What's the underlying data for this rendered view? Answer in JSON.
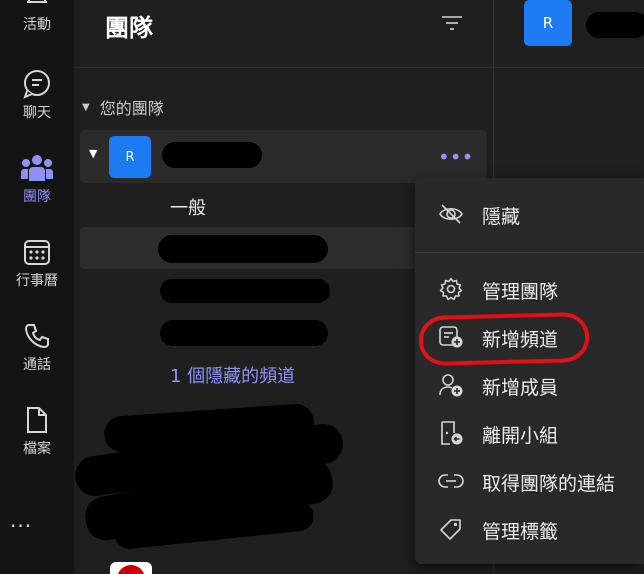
{
  "rail": {
    "items": [
      {
        "label": "活動",
        "icon": "bell-icon"
      },
      {
        "label": "聊天",
        "icon": "chat-icon"
      },
      {
        "label": "團隊",
        "icon": "teams-icon",
        "active": true
      },
      {
        "label": "行事曆",
        "icon": "calendar-icon"
      },
      {
        "label": "通話",
        "icon": "phone-icon"
      },
      {
        "label": "檔案",
        "icon": "file-icon"
      }
    ],
    "more": "..."
  },
  "panel": {
    "title": "團隊",
    "section_label": "您的團隊",
    "team": {
      "avatar_initial": "R"
    },
    "channels": [
      "一般"
    ],
    "hidden_channels": "1 個隱藏的頻道"
  },
  "header": {
    "user_initial": "R"
  },
  "menu": {
    "items": [
      {
        "label": "隱藏",
        "icon": "eye-off-icon"
      },
      {
        "label": "管理團隊",
        "icon": "gear-icon"
      },
      {
        "label": "新增頻道",
        "icon": "add-channel-icon"
      },
      {
        "label": "新增成員",
        "icon": "add-member-icon"
      },
      {
        "label": "離開小組",
        "icon": "leave-team-icon"
      },
      {
        "label": "取得團隊的連結",
        "icon": "link-icon"
      },
      {
        "label": "管理標籤",
        "icon": "tag-icon"
      }
    ]
  },
  "colors": {
    "accent": "#8e92f5",
    "avatar": "#1c7af2",
    "highlight": "#e3101a"
  }
}
